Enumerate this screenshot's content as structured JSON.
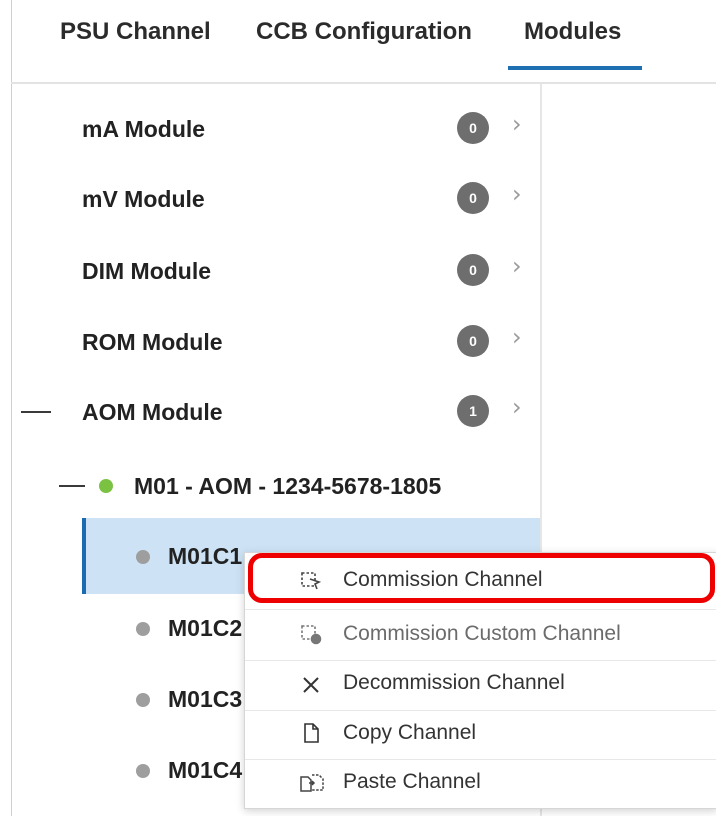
{
  "tabs": [
    {
      "label": "PSU Channel",
      "active": false
    },
    {
      "label": "CCB Configuration",
      "active": false
    },
    {
      "label": "Modules",
      "active": true
    }
  ],
  "modules": [
    {
      "label": "mA Module",
      "count": "0"
    },
    {
      "label": "mV Module",
      "count": "0"
    },
    {
      "label": "DIM Module",
      "count": "0"
    },
    {
      "label": "ROM Module",
      "count": "0"
    },
    {
      "label": "AOM Module",
      "count": "1",
      "expanded": true
    }
  ],
  "device": {
    "label": "M01 - AOM - 1234-5678-1805",
    "status": "online",
    "status_color": "#7cc242"
  },
  "channels": [
    {
      "label": "M01C1",
      "selected": true
    },
    {
      "label": "M01C2"
    },
    {
      "label": "M01C3"
    },
    {
      "label": "M01C4"
    }
  ],
  "context_menu": {
    "items": [
      {
        "label": "Commission Channel",
        "icon": "commission-icon",
        "highlighted": true
      },
      {
        "label": "Commission Custom Channel",
        "icon": "commission-custom-icon"
      },
      {
        "label": "Decommission Channel",
        "icon": "close-icon"
      },
      {
        "label": "Copy Channel",
        "icon": "copy-icon"
      },
      {
        "label": "Paste Channel",
        "icon": "paste-icon"
      }
    ]
  },
  "colors": {
    "accent": "#1f6fb3",
    "highlight": "#ee0000",
    "selected_bg": "#cde3f5",
    "badge": "#6e6e6e",
    "channel_dot": "#9e9e9e"
  }
}
